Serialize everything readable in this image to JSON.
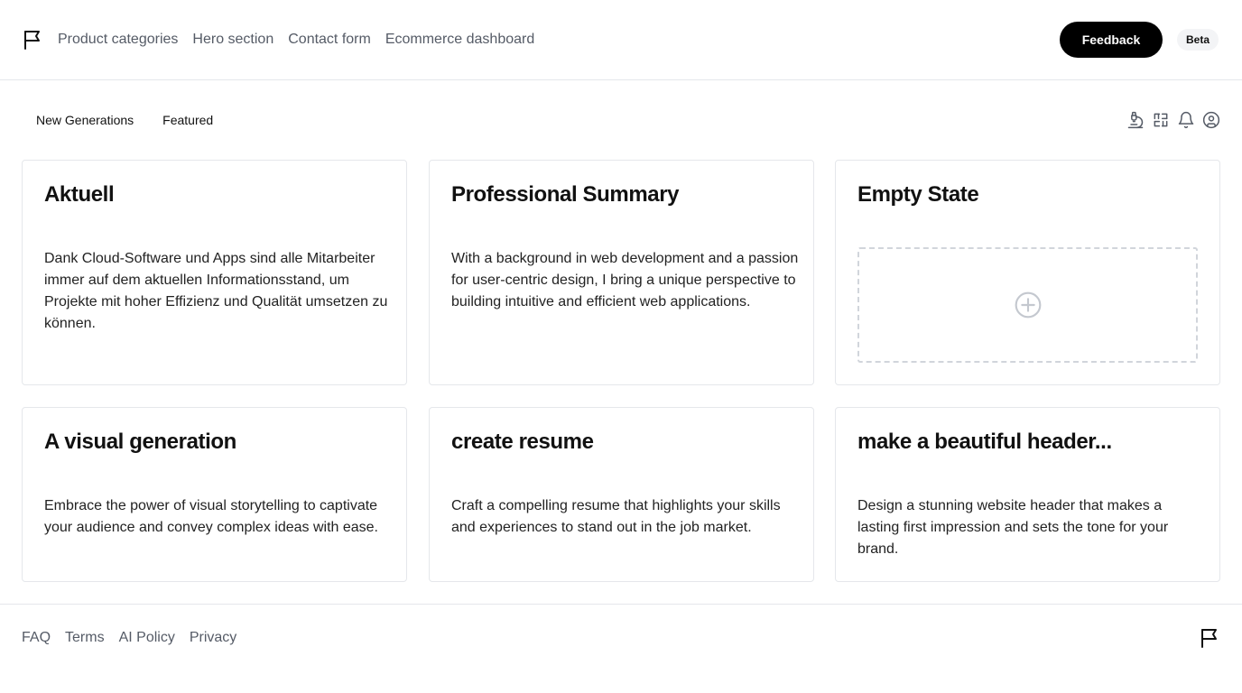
{
  "header": {
    "nav": [
      "Product categories",
      "Hero section",
      "Contact form",
      "Ecommerce dashboard"
    ],
    "feedback_label": "Feedback",
    "beta_label": "Beta"
  },
  "tabs": [
    "New Generations",
    "Featured"
  ],
  "toolbar_icons": [
    "microscope-icon",
    "scan-icon",
    "bell-icon",
    "user-circle-icon"
  ],
  "cards": [
    {
      "title": "Aktuell",
      "text": "Dank Cloud-Software und Apps sind alle Mitarbeiter immer auf dem aktuellen Informationsstand, um Projekte mit hoher Effizienz und Qualität umsetzen zu können."
    },
    {
      "title": "Professional Summary",
      "text": "With a background in web development and a passion for user-centric design, I bring a unique perspective to building intuitive and efficient web applications."
    },
    {
      "title": "Empty State",
      "text": ""
    },
    {
      "title": "A visual generation",
      "text": "Embrace the power of visual storytelling to captivate your audience and convey complex ideas with ease."
    },
    {
      "title": "create resume",
      "text": "Craft a compelling resume that highlights your skills and experiences to stand out in the job market."
    },
    {
      "title": "make a beautiful header...",
      "text": "Design a stunning website header that makes a lasting first impression and sets the tone for your brand."
    }
  ],
  "footer": {
    "links": [
      "FAQ",
      "Terms",
      "AI Policy",
      "Privacy"
    ]
  },
  "colors": {
    "text": "#111111",
    "muted": "#555b66",
    "border": "#e5e7eb",
    "button_bg": "#000000"
  }
}
